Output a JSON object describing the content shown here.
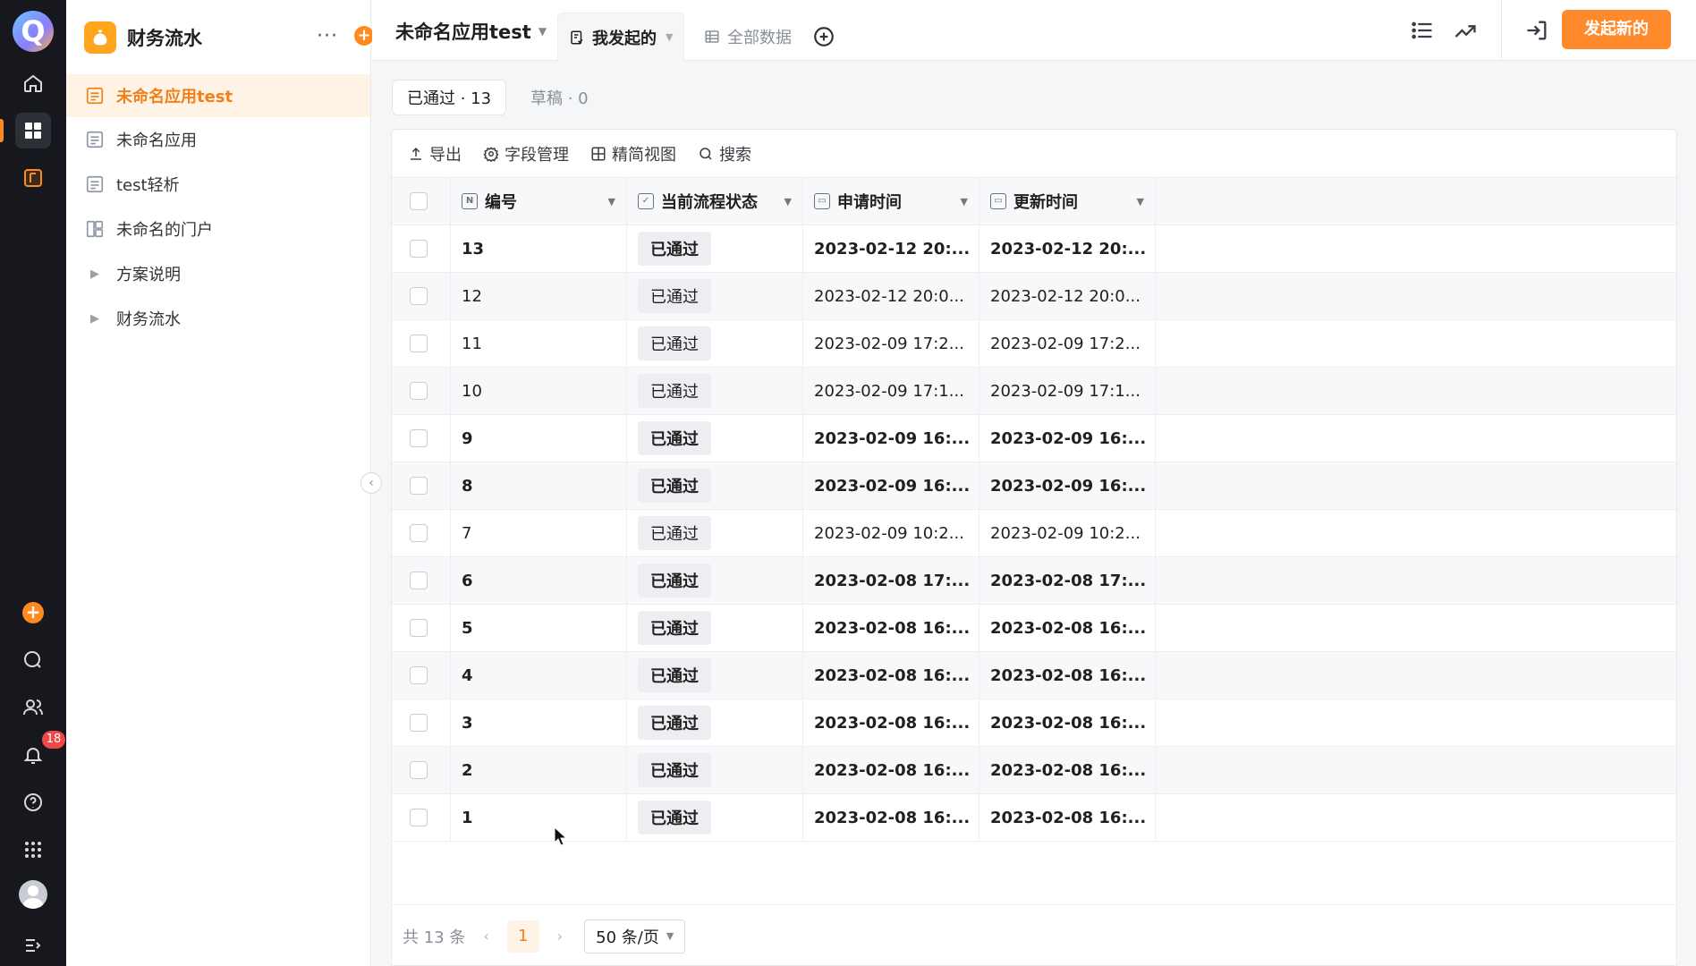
{
  "rail": {
    "notification_count": "18"
  },
  "sidenav": {
    "app_name": "财务流水",
    "more": "···",
    "add": "+",
    "items": [
      {
        "label": "未命名应用test",
        "type": "form",
        "active": true
      },
      {
        "label": "未命名应用",
        "type": "form",
        "active": false
      },
      {
        "label": "test轻析",
        "type": "form",
        "active": false
      },
      {
        "label": "未命名的门户",
        "type": "portal",
        "active": false
      },
      {
        "label": "方案说明",
        "type": "folder",
        "active": false
      },
      {
        "label": "财务流水",
        "type": "folder",
        "active": false
      }
    ]
  },
  "topbar": {
    "app_title": "未命名应用test",
    "tabs": [
      {
        "label": "我发起的",
        "active": true
      },
      {
        "label": "全部数据",
        "active": false
      }
    ],
    "launch_button": "发起新的"
  },
  "status_tabs": [
    {
      "label": "已通过 · 13",
      "active": true
    },
    {
      "label": "草稿 · 0",
      "active": false
    }
  ],
  "toolbar": {
    "export": "导出",
    "fields": "字段管理",
    "compact": "精简视图",
    "search": "搜索"
  },
  "table": {
    "columns": [
      "编号",
      "当前流程状态",
      "申请时间",
      "更新时间"
    ],
    "rows": [
      {
        "id": "13",
        "status": "已通过",
        "applied": "2023-02-12 20:...",
        "updated": "2023-02-12 20:...",
        "bold": true
      },
      {
        "id": "12",
        "status": "已通过",
        "applied": "2023-02-12 20:0...",
        "updated": "2023-02-12 20:0...",
        "bold": false
      },
      {
        "id": "11",
        "status": "已通过",
        "applied": "2023-02-09 17:2...",
        "updated": "2023-02-09 17:2...",
        "bold": false
      },
      {
        "id": "10",
        "status": "已通过",
        "applied": "2023-02-09 17:1...",
        "updated": "2023-02-09 17:1...",
        "bold": false
      },
      {
        "id": "9",
        "status": "已通过",
        "applied": "2023-02-09 16:...",
        "updated": "2023-02-09 16:...",
        "bold": true
      },
      {
        "id": "8",
        "status": "已通过",
        "applied": "2023-02-09 16:...",
        "updated": "2023-02-09 16:...",
        "bold": true
      },
      {
        "id": "7",
        "status": "已通过",
        "applied": "2023-02-09 10:2...",
        "updated": "2023-02-09 10:2...",
        "bold": false
      },
      {
        "id": "6",
        "status": "已通过",
        "applied": "2023-02-08 17:...",
        "updated": "2023-02-08 17:...",
        "bold": true
      },
      {
        "id": "5",
        "status": "已通过",
        "applied": "2023-02-08 16:...",
        "updated": "2023-02-08 16:...",
        "bold": true
      },
      {
        "id": "4",
        "status": "已通过",
        "applied": "2023-02-08 16:...",
        "updated": "2023-02-08 16:...",
        "bold": true
      },
      {
        "id": "3",
        "status": "已通过",
        "applied": "2023-02-08 16:...",
        "updated": "2023-02-08 16:...",
        "bold": true
      },
      {
        "id": "2",
        "status": "已通过",
        "applied": "2023-02-08 16:...",
        "updated": "2023-02-08 16:...",
        "bold": true
      },
      {
        "id": "1",
        "status": "已通过",
        "applied": "2023-02-08 16:...",
        "updated": "2023-02-08 16:...",
        "bold": true
      }
    ]
  },
  "pagination": {
    "total": "共 13 条",
    "current_page": "1",
    "page_size": "50 条/页"
  },
  "colors": {
    "accent": "#ff8a2b",
    "rail_bg": "#16181d",
    "active_bg": "#fff3e6"
  }
}
